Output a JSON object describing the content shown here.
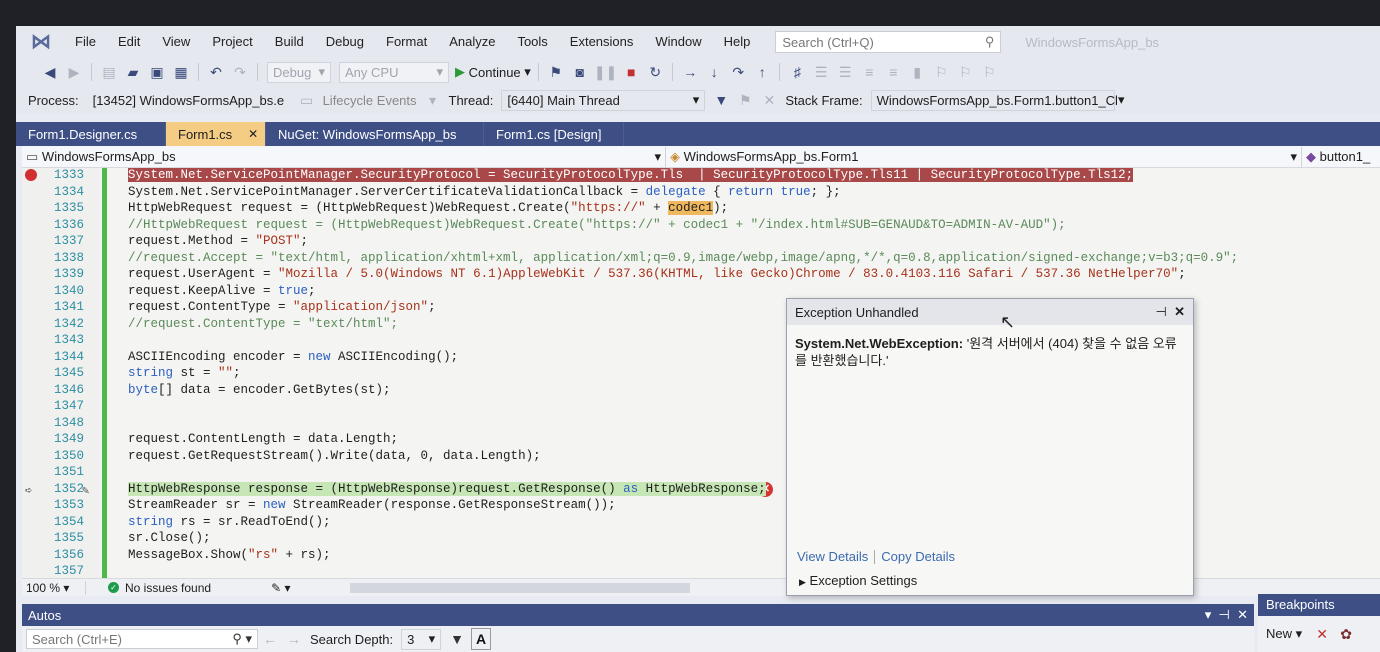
{
  "menu": [
    "File",
    "Edit",
    "View",
    "Project",
    "Build",
    "Debug",
    "Format",
    "Analyze",
    "Tools",
    "Extensions",
    "Window",
    "Help"
  ],
  "search": {
    "placeholder": "Search (Ctrl+Q)"
  },
  "app_title": "WindowsFormsApp_bs",
  "toolbar": {
    "config": "Debug",
    "platform": "Any CPU",
    "continue_label": "Continue"
  },
  "debugbar": {
    "process_label": "Process:",
    "process_value": "[13452] WindowsFormsApp_bs.e",
    "lifecycle_label": "Lifecycle Events",
    "thread_label": "Thread:",
    "thread_value": "[6440] Main Thread",
    "stackframe_label": "Stack Frame:",
    "stackframe_value": "WindowsFormsApp_bs.Form1.button1_Cl"
  },
  "tabs": [
    {
      "label": "Form1.Designer.cs",
      "active": false
    },
    {
      "label": "Form1.cs",
      "active": true
    },
    {
      "label": "NuGet: WindowsFormsApp_bs",
      "active": false
    },
    {
      "label": "Form1.cs [Design]",
      "active": false
    }
  ],
  "navbar": {
    "project": "WindowsFormsApp_bs",
    "class": "WindowsFormsApp_bs.Form1",
    "member": "button1_"
  },
  "code_lines": [
    {
      "num": "1333",
      "text": "System.Net.ServicePointManager.SecurityProtocol = SecurityProtocolType.Tls  | SecurityProtocolType.Tls11 | SecurityProtocolType.Tls12;"
    },
    {
      "num": "1334",
      "text": "System.Net.ServicePointManager.ServerCertificateValidationCallback = delegate { return true; };"
    },
    {
      "num": "1335",
      "text": "HttpWebRequest request = (HttpWebRequest)WebRequest.Create(\"https://\" + codec1);"
    },
    {
      "num": "1336",
      "text": "//HttpWebRequest request = (HttpWebRequest)WebRequest.Create(\"https://\" + codec1 + \"/index.html#SUB=GENAUD&TO=ADMIN-AV-AUD\");"
    },
    {
      "num": "1337",
      "text": "request.Method = \"POST\";"
    },
    {
      "num": "1338",
      "text": "//request.Accept = \"text/html, application/xhtml+xml, application/xml;q=0.9,image/webp,image/apng,*/*,q=0.8,application/signed-exchange;v=b3;q=0.9\";"
    },
    {
      "num": "1339",
      "text": "request.UserAgent = \"Mozilla / 5.0(Windows NT 6.1)AppleWebKit / 537.36(KHTML, like Gecko)Chrome / 83.0.4103.116 Safari / 537.36 NetHelper70\";"
    },
    {
      "num": "1340",
      "text": "request.KeepAlive = true;"
    },
    {
      "num": "1341",
      "text": "request.ContentType = \"application/json\";"
    },
    {
      "num": "1342",
      "text": "//request.ContentType = \"text/html\";"
    },
    {
      "num": "1343",
      "text": ""
    },
    {
      "num": "1344",
      "text": "ASCIIEncoding encoder = new ASCIIEncoding();"
    },
    {
      "num": "1345",
      "text": "string st = \"\";"
    },
    {
      "num": "1346",
      "text": "byte[] data = encoder.GetBytes(st);"
    },
    {
      "num": "1347",
      "text": ""
    },
    {
      "num": "1348",
      "text": ""
    },
    {
      "num": "1349",
      "text": "request.ContentLength = data.Length;"
    },
    {
      "num": "1350",
      "text": "request.GetRequestStream().Write(data, 0, data.Length);"
    },
    {
      "num": "1351",
      "text": ""
    },
    {
      "num": "1352",
      "text": "HttpWebResponse response = (HttpWebResponse)request.GetResponse() as HttpWebResponse;"
    },
    {
      "num": "1353",
      "text": "StreamReader sr = new StreamReader(response.GetResponseStream());"
    },
    {
      "num": "1354",
      "text": "string rs = sr.ReadToEnd();"
    },
    {
      "num": "1355",
      "text": "sr.Close();"
    },
    {
      "num": "1356",
      "text": "MessageBox.Show(\"rs\" + rs);"
    },
    {
      "num": "1357",
      "text": ""
    }
  ],
  "editor_status": {
    "zoom": "100 %",
    "issues": "No issues found"
  },
  "exception": {
    "title": "Exception Unhandled",
    "type": "System.Net.WebException:",
    "message": "'원격 서버에서 (404) 찾을 수 없음 오류를 반환했습니다.'",
    "view_details": "View Details",
    "copy_details": "Copy Details",
    "settings": "Exception Settings"
  },
  "autos": {
    "title": "Autos",
    "search_placeholder": "Search (Ctrl+E)",
    "depth_label": "Search Depth:",
    "depth_value": "3"
  },
  "breakpoints": {
    "title": "Breakpoints",
    "new_label": "New"
  },
  "colors": {
    "tab_bar": "#3e4f86",
    "active_tab": "#f5cc84",
    "breakpoint_line": "#a94848",
    "current_line": "#c7e6b5",
    "change_bar": "#4fb84a"
  }
}
